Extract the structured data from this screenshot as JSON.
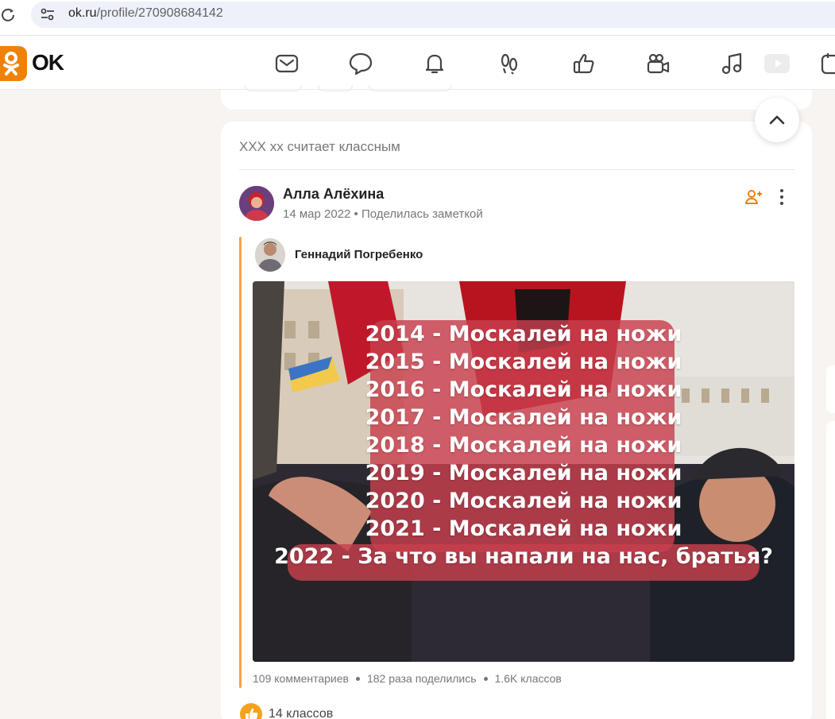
{
  "browser": {
    "url_host": "ok.ru",
    "url_path": "/profile/270908684142"
  },
  "header": {
    "logo_text": "OK",
    "nav_icons": [
      "mail-icon",
      "chat-icon",
      "bell-icon",
      "guests-icon",
      "like-icon",
      "video-camera-icon",
      "music-icon",
      "video-play-icon",
      "calendar-icon"
    ]
  },
  "post": {
    "feed_caption": "XXX xx считает классным",
    "author_name": "Алла Алёхина",
    "date": "14 мар 2022",
    "action": "Поделилась заметкой",
    "quoted_author": "Геннадий Погребенко",
    "image_lines": [
      "2014 - Москалей на ножи",
      "2015 - Москалей на ножи",
      "2016 - Москалей на ножи",
      "2017 - Москалей на ножи",
      "2018 - Москалей на ножи",
      "2019 - Москалей на ножи",
      "2020  - Москалей на ножи",
      "2021 - Москалей на ножи",
      "2022 - За что вы напали на нас, братья?"
    ],
    "stats": {
      "comments": "109 комментариев",
      "shares": "182 раза поделились",
      "classes": "1.6K классов"
    },
    "likes_label": "14 классов"
  },
  "colors": {
    "brand_orange": "#ee8208",
    "quote_line": "#f7a24b",
    "background": "#f7f4f1",
    "text_band": "#c8404d"
  }
}
